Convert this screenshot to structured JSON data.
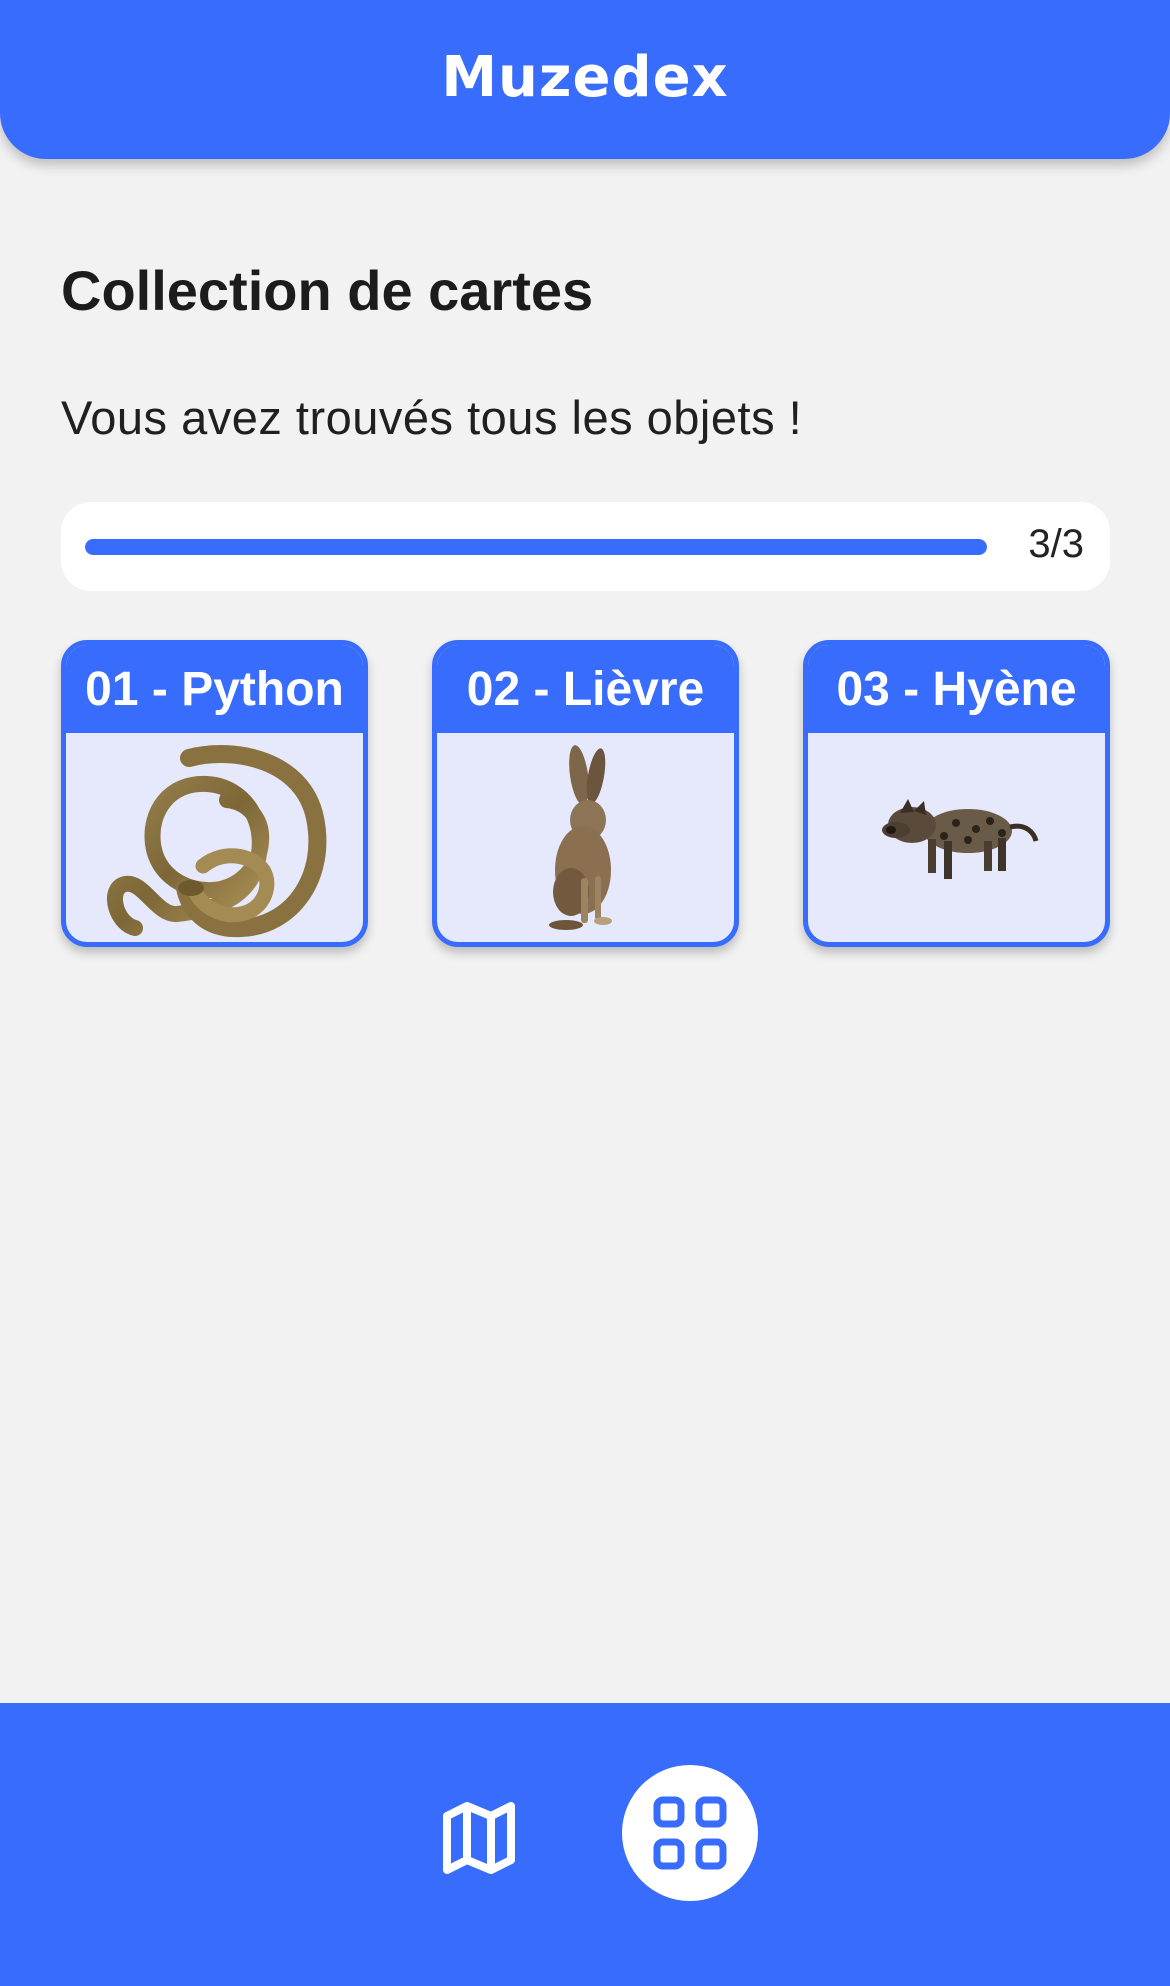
{
  "header": {
    "title": "Muzedex"
  },
  "main": {
    "page_title": "Collection de cartes",
    "subtitle": "Vous avez trouvés tous les objets !",
    "progress": {
      "found": 3,
      "total": 3,
      "label": "3/3",
      "fraction": 1.0
    },
    "cards": [
      {
        "label": "01 - Python",
        "image_icon": "python-icon"
      },
      {
        "label": "02 - Lièvre",
        "image_icon": "hare-icon"
      },
      {
        "label": "03 - Hyène",
        "image_icon": "hyena-icon"
      }
    ]
  },
  "bottom_nav": {
    "items": [
      {
        "icon": "map-icon",
        "active": false
      },
      {
        "icon": "grid-icon",
        "active": true
      }
    ]
  },
  "colors": {
    "accent": "#386cfc",
    "background": "#f2f2f2",
    "card_background": "#e5e9fb",
    "text": "#1c1c1c"
  }
}
